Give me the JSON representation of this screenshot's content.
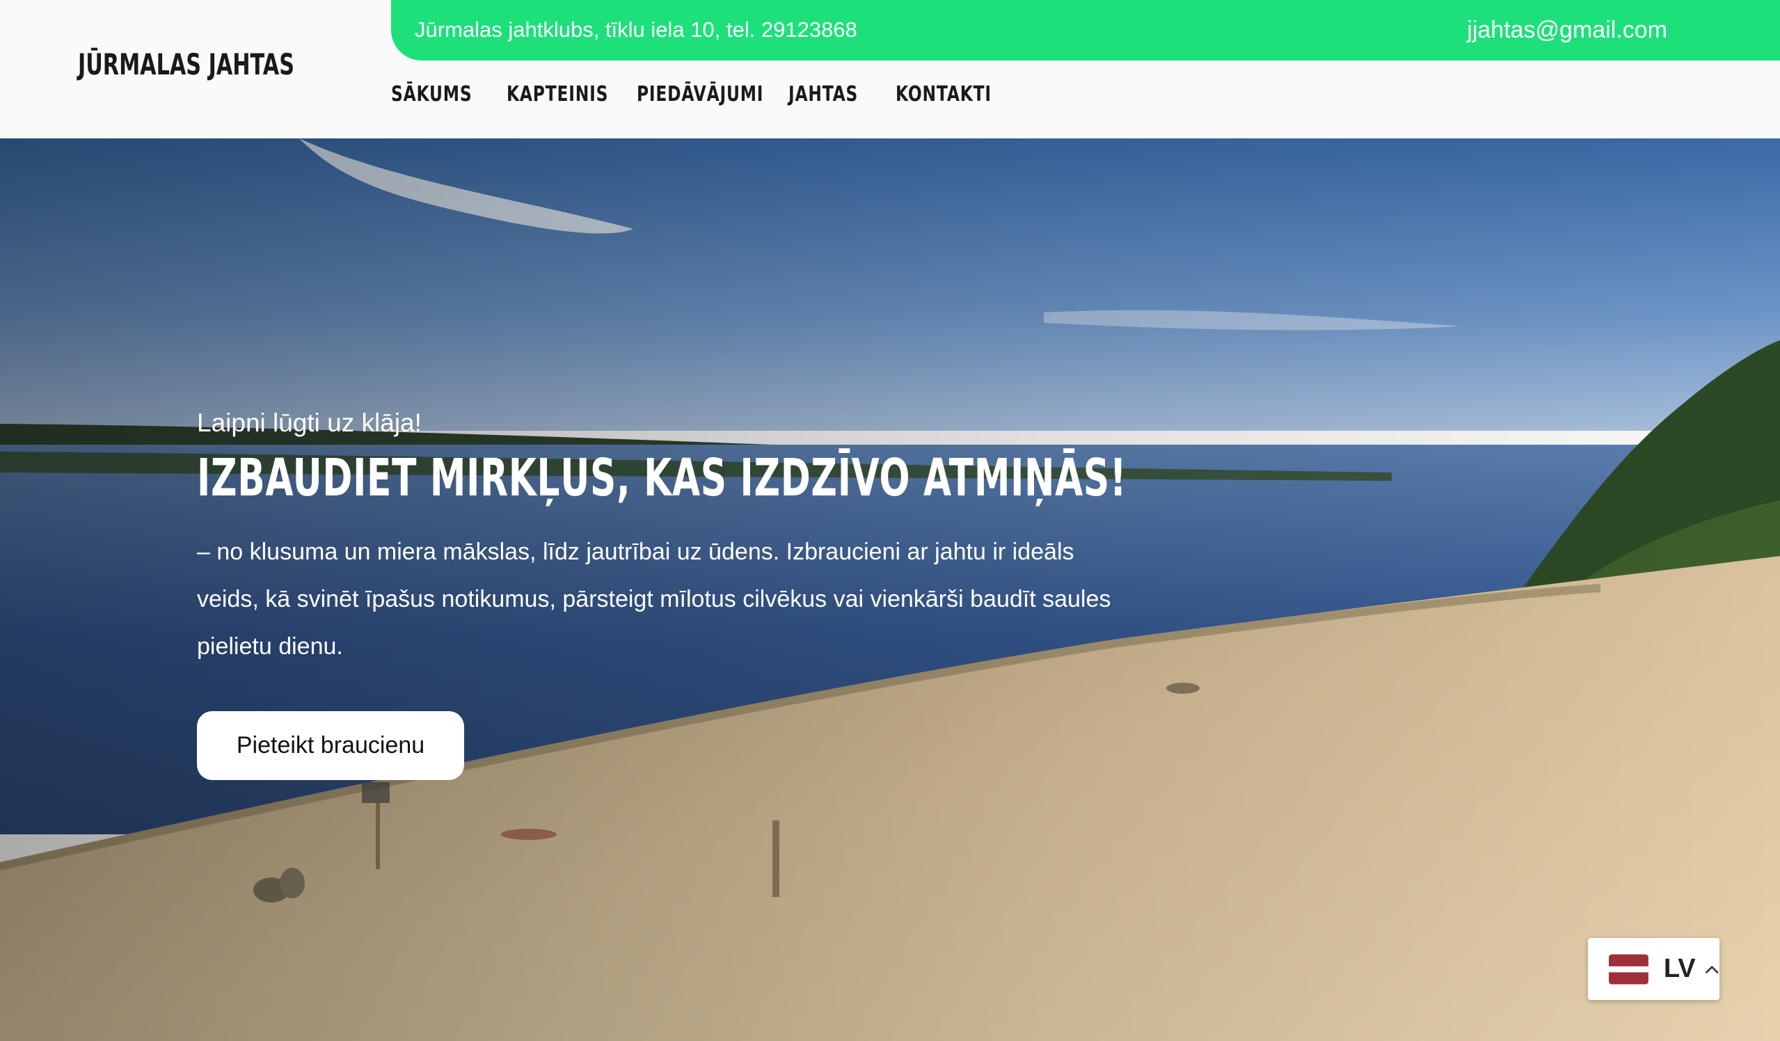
{
  "header": {
    "logo": "JŪRMALAS JAHTAS",
    "topbar": {
      "address": "Jūrmalas jahtklubs, tīklu iela 10, tel. 29123868",
      "email": "jjahtas@gmail.com"
    },
    "nav": [
      {
        "label": "SĀKUMS"
      },
      {
        "label": "KAPTEINIS"
      },
      {
        "label": "PIEDĀVĀJUMI"
      },
      {
        "label": "JAHTAS"
      },
      {
        "label": "KONTAKTI"
      }
    ]
  },
  "hero": {
    "kicker": "Laipni lūgti uz klāja!",
    "headline": "IZBAUDIET MIRKĻUS, KAS IZDZĪVO ATMIŅĀS!",
    "description": "– no klusuma un miera mākslas, līdz jautrībai uz ūdens. Izbraucieni ar jahtu ir ideāls veids, kā svinēt īpašus notikumus, pārsteigt mīlotus cilvēkus vai vienkārši baudīt saules pielietu dienu.",
    "cta": "Pieteikt braucienu"
  },
  "language_switcher": {
    "code": "LV",
    "flag_icon": "latvia-flag-icon",
    "chevron_icon": "chevron-up-icon"
  },
  "colors": {
    "topbar": "#1ee07b",
    "header_bg": "#fafafa",
    "text_dark": "#1a1a1a",
    "latvia_red": "#9e3039"
  }
}
